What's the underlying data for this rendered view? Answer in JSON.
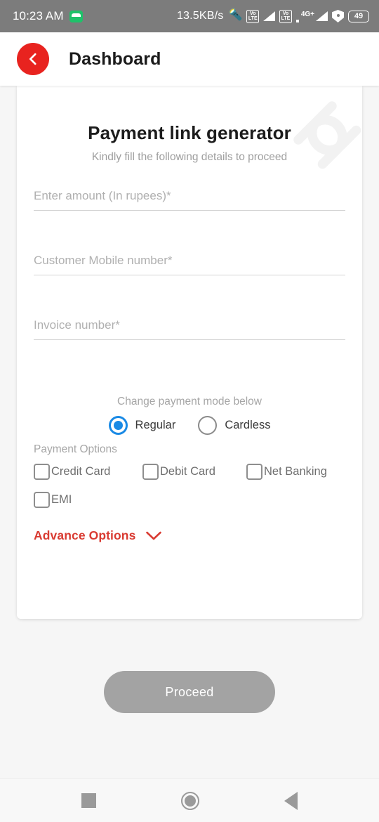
{
  "status_bar": {
    "time": "10:23 AM",
    "notification_icon": "app-notification-icon",
    "network_speed": "13.5KB/s",
    "bluetooth_icon": "bluetooth-icon",
    "volte1_label": "Vo\nLTE",
    "volte1_top": "Vo",
    "volte1_bottom": "LTE",
    "volte2_top": "Vo",
    "volte2_bottom": "LTE",
    "data_type": "4G+",
    "wifi_icon": "wifi-shield-icon",
    "battery_level": "49"
  },
  "header": {
    "back_icon": "chevron-left-icon",
    "title": "Dashboard"
  },
  "card": {
    "watermark_icon": "chain-link-watermark-icon",
    "title": "Payment link generator",
    "subtitle": "Kindly fill the following details to proceed",
    "fields": [
      {
        "name": "amount",
        "value": "",
        "placeholder": "Enter amount (In rupees)*"
      },
      {
        "name": "mobile",
        "value": "",
        "placeholder": "Customer Mobile number*"
      },
      {
        "name": "invoice",
        "value": "",
        "placeholder": "Invoice number*"
      }
    ],
    "payment_mode": {
      "label": "Change payment mode below",
      "options": [
        {
          "label": "Regular",
          "selected": true
        },
        {
          "label": "Cardless",
          "selected": false
        }
      ]
    },
    "payment_options": {
      "label": "Payment Options",
      "items": [
        {
          "label": "Credit Card",
          "checked": false
        },
        {
          "label": "Debit Card",
          "checked": false
        },
        {
          "label": "Net Banking",
          "checked": false
        },
        {
          "label": "EMI",
          "checked": false
        }
      ]
    },
    "advance_options": {
      "label": "Advance Options",
      "icon": "chevron-down-icon",
      "expanded": false
    },
    "proceed_label": "Proceed"
  },
  "nav_bar": {
    "recents_icon": "square-recents-icon",
    "home_icon": "circle-home-icon",
    "back_icon": "triangle-back-icon"
  },
  "colors": {
    "accent_red": "#e8231f",
    "advance_red": "#d93b32",
    "radio_blue": "#1a8ae5",
    "proceed_gray": "#a3a3a3",
    "status_bar_gray": "#7c7c7c",
    "page_bg": "#f6f6f6"
  }
}
